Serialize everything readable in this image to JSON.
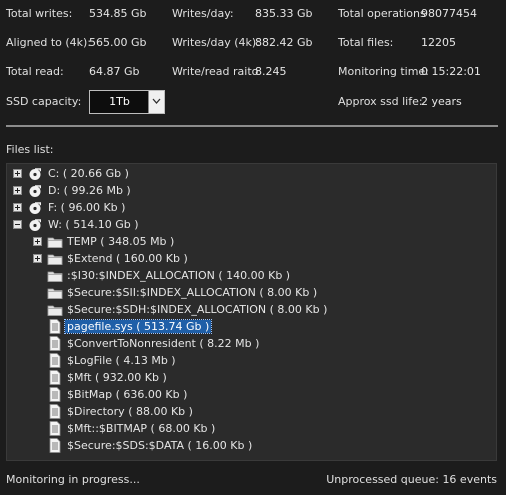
{
  "stats": {
    "total_writes_label": "Total writes:",
    "total_writes": "534.85 Gb",
    "writes_day_label": "Writes/day:",
    "writes_day": "835.33 Gb",
    "total_ops_label": "Total operations",
    "total_ops": "98077454",
    "aligned_label": "Aligned to (4k):",
    "aligned": "565.00 Gb",
    "writes_day4k_label": "Writes/day (4k):",
    "writes_day4k": "882.42 Gb",
    "total_files_label": "Total files:",
    "total_files": "12205",
    "total_read_label": "Total read:",
    "total_read": "64.87 Gb",
    "wr_ratio_label": "Write/read raito",
    "wr_ratio": "8.245",
    "mon_time_label": "Monitoring time:",
    "mon_time": "0 15:22:01",
    "ssd_cap_label": "SSD capacity:",
    "ssd_cap": "1Tb",
    "ssd_life_label": "Approx ssd life:",
    "ssd_life": "2 years"
  },
  "files_list_label": "Files list:",
  "tree": {
    "c": "C: ( 20.66 Gb )",
    "d": "D: ( 99.26 Mb )",
    "f": "F: ( 96.00 Kb )",
    "w": "W: ( 514.10 Gb )",
    "temp": "TEMP ( 348.05 Mb )",
    "extend": "$Extend ( 160.00 Kb )",
    "i30": ":$I30:$INDEX_ALLOCATION ( 140.00 Kb )",
    "sii": "$Secure:$SII:$INDEX_ALLOCATION ( 8.00 Kb )",
    "sdh": "$Secure:$SDH:$INDEX_ALLOCATION ( 8.00 Kb )",
    "pagefile": "pagefile.sys ( 513.74 Gb )",
    "convert": "$ConvertToNonresident ( 8.22 Mb )",
    "logfile": "$LogFile ( 4.13 Mb )",
    "mft": "$Mft ( 932.00 Kb )",
    "bitmap": "$BitMap ( 636.00 Kb )",
    "directory": "$Directory ( 88.00 Kb )",
    "mftbitmap": "$Mft::$BITMAP ( 68.00 Kb )",
    "sds": "$Secure:$SDS:$DATA ( 16.00 Kb )"
  },
  "status": {
    "left": "Monitoring in progress...",
    "right": "Unprocessed queue: 16 events"
  },
  "icons": {
    "disk": "disk-icon",
    "folder": "folder-icon",
    "file": "file-icon",
    "expand": "expand-plus-icon",
    "collapse": "collapse-minus-icon"
  },
  "colors": {
    "background": "#1c1c1c",
    "tree_bg": "#2b2b2b",
    "selection": "#1f5fa8"
  }
}
